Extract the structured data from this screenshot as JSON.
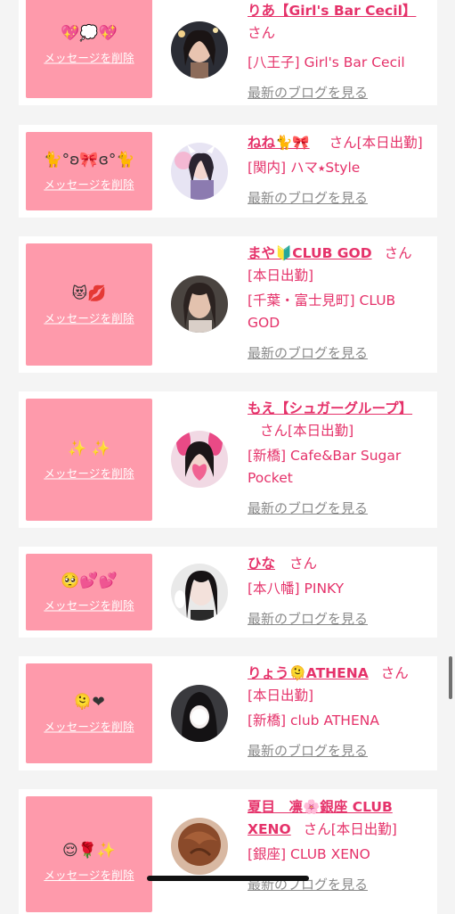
{
  "delete_label": "メッセージを削除",
  "blog_label": "最新のブログを見る",
  "san_label": "さん",
  "today_label": "[本日出勤]",
  "colors": {
    "accent_pink": "#e5326a",
    "message_box": "#fe9aab",
    "blog_link": "#8a8a8a",
    "background": "#f4f4f4"
  },
  "cards": [
    {
      "emoji": "💖💭💖",
      "name": "りあ【Girl's Bar Cecil】",
      "shop": "[八王子] Girl's Bar Cecil",
      "today": ""
    },
    {
      "emoji": "🐈°ʚ🎀ɞ°🐈",
      "name": "ねね🐈🎀",
      "shop": "[関内] ハマ⭑Style",
      "today": "[本日出勤]"
    },
    {
      "emoji": "😻💋",
      "name": "まや🔰CLUB GOD",
      "shop": "[千葉・富士見町] CLUB GOD",
      "today": "[本日出勤]"
    },
    {
      "emoji": "✨ ✨",
      "name": "もえ【シュガーグループ】",
      "shop": "[新橋] Cafe&Bar Sugar Pocket",
      "today": "[本日出勤]"
    },
    {
      "emoji": "🥺💕💕",
      "name": "ひな",
      "shop": "[本八幡] PINKY",
      "today": ""
    },
    {
      "emoji": "🫠❤",
      "name": "りょう🫠ATHENA",
      "shop": "[新橋] club ATHENA",
      "today": "[本日出勤]"
    },
    {
      "emoji": "😌🌹✨",
      "name": "夏目　凛🌸銀座 CLUB XENO",
      "shop": "[銀座] CLUB XENO",
      "today": "[本日出勤]"
    }
  ]
}
